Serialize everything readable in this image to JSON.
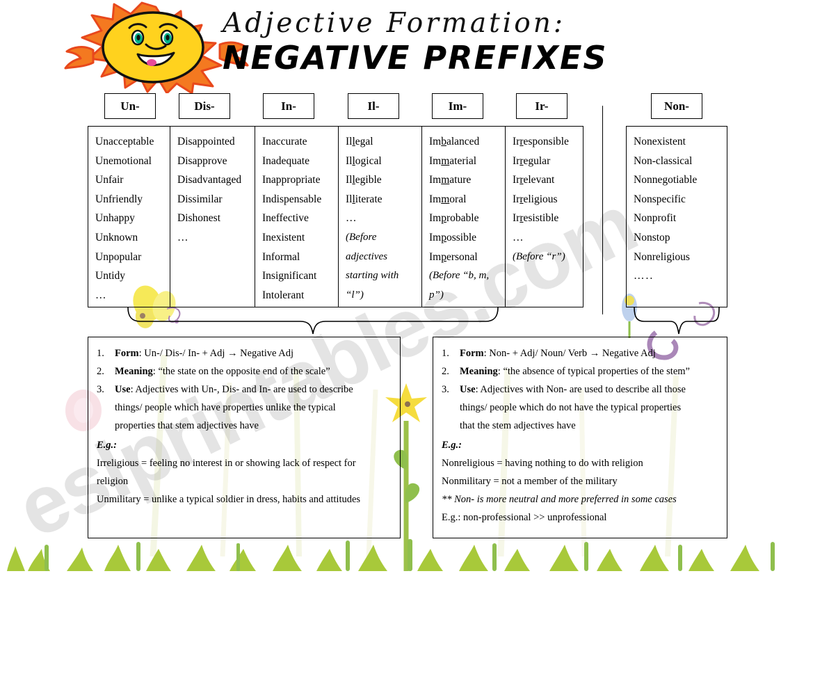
{
  "title": {
    "script_line": "Adjective Formation:",
    "main_line": "NEGATIVE PREFIXES"
  },
  "watermark": {
    "text": "eslprintables.com"
  },
  "prefix_headers": [
    {
      "label": "Un-"
    },
    {
      "label": "Dis-"
    },
    {
      "label": "In-"
    },
    {
      "label": "Il-"
    },
    {
      "label": "Im-"
    },
    {
      "label": "Ir-"
    },
    {
      "label": "Non-"
    }
  ],
  "columns": {
    "un": {
      "prefix": "Un-",
      "words": [
        "Unacceptable",
        "Unemotional",
        "Unfair",
        "Unfriendly",
        "Unhappy",
        "Unknown",
        "Unpopular",
        "Untidy"
      ],
      "ellipsis": "…"
    },
    "dis": {
      "prefix": "Dis-",
      "words": [
        "Disappointed",
        "Disapprove",
        "Disadvantaged",
        "Dissimilar",
        "Dishonest"
      ],
      "ellipsis": "…"
    },
    "in": {
      "prefix": "In-",
      "words": [
        "Inaccurate",
        "Inadequate",
        "Inappropriate",
        "Indispensable",
        "Ineffective",
        "Inexistent",
        "Informal",
        "Insignificant",
        "Intolerant"
      ],
      "ellipsis": ""
    },
    "il": {
      "prefix": "Il-",
      "words": [
        {
          "pre": "Il",
          "mark": "l",
          "post": "egal"
        },
        {
          "pre": "Il",
          "mark": "l",
          "post": "ogical"
        },
        {
          "pre": "Il",
          "mark": "l",
          "post": "egible"
        },
        {
          "pre": "Il",
          "mark": "l",
          "post": "iterate"
        }
      ],
      "ellipsis": "…",
      "note": "(Before adjectives starting with “l”)"
    },
    "im": {
      "prefix": "Im-",
      "words": [
        {
          "pre": "Im",
          "mark": "b",
          "post": "alanced"
        },
        {
          "pre": "Im",
          "mark": "m",
          "post": "aterial"
        },
        {
          "pre": "Im",
          "mark": "m",
          "post": "ature"
        },
        {
          "pre": "Im",
          "mark": "m",
          "post": "oral"
        },
        {
          "pre": "Im",
          "mark": "p",
          "post": "robable"
        },
        {
          "pre": "Im",
          "mark": "p",
          "post": "ossible"
        },
        {
          "pre": "Im",
          "mark": "p",
          "post": "ersonal"
        }
      ],
      "ellipsis": "",
      "note": "(Before “b, m, p”)"
    },
    "ir": {
      "prefix": "Ir-",
      "words": [
        {
          "pre": "Ir",
          "mark": "r",
          "post": "esponsible"
        },
        {
          "pre": "Ir",
          "mark": "r",
          "post": "egular"
        },
        {
          "pre": "Ir",
          "mark": "r",
          "post": "elevant"
        },
        {
          "pre": "Ir",
          "mark": "r",
          "post": "eligious"
        },
        {
          "pre": "Ir",
          "mark": "r",
          "post": "esistible"
        }
      ],
      "ellipsis": "…",
      "note": "(Before “r”)"
    },
    "non": {
      "prefix": "Non-",
      "words": [
        "Nonexistent",
        "Non-classical",
        "Nonnegotiable",
        "Nonspecific",
        "Nonprofit",
        "Nonstop",
        "Nonreligious"
      ],
      "ellipsis": "….."
    }
  },
  "left_box": {
    "items": [
      {
        "num": "1.",
        "label": "Form",
        "sep": ": ",
        "text": "Un-/ Dis-/ In- + Adj → Negative Adj"
      },
      {
        "num": "2.",
        "label": "Meaning",
        "sep": ": ",
        "text": "“the state on the opposite end of the scale”"
      },
      {
        "num": "3.",
        "label": "Use",
        "sep": ": ",
        "text": "Adjectives with Un-, Dis- and In- are used to describe"
      }
    ],
    "continuation": [
      "things/ people which have properties unlike the typical",
      "properties that stem adjectives have"
    ],
    "eg_label": "E.g.:",
    "examples": [
      "Irreligious = feeling no interest in or showing lack of respect for",
      "religion",
      "Unmilitary = unlike a typical soldier in dress, habits and attitudes"
    ]
  },
  "right_box": {
    "items": [
      {
        "num": "1.",
        "label": "Form",
        "sep": ": ",
        "text": "Non- + Adj/ Noun/ Verb → Negative Adj"
      },
      {
        "num": "2.",
        "label": "Meaning",
        "sep": ": ",
        "text": "“the absence of typical properties of the stem”"
      },
      {
        "num": "3.",
        "label": "Use",
        "sep": ": ",
        "text": "Adjectives with Non- are used to describe all those"
      }
    ],
    "continuation": [
      "things/ people which do not have the typical properties",
      "that the stem adjectives have"
    ],
    "eg_label": "E.g.:",
    "examples": [
      "Nonreligious = having nothing to do with religion",
      "Nonmilitary = not a member of the military"
    ],
    "note_italic": "** Non- is more neutral and more preferred in some cases",
    "note_last": "E.g.: non-professional >> unprofessional"
  },
  "colors": {
    "sun_face": "#FFD21E",
    "sun_rays": "#F47920",
    "sun_outline": "#E8481C",
    "eye": "#00B38A",
    "tongue": "#E84C9A",
    "grass": "#A8C93A",
    "flower": "#F2E235",
    "border": "#000000"
  }
}
